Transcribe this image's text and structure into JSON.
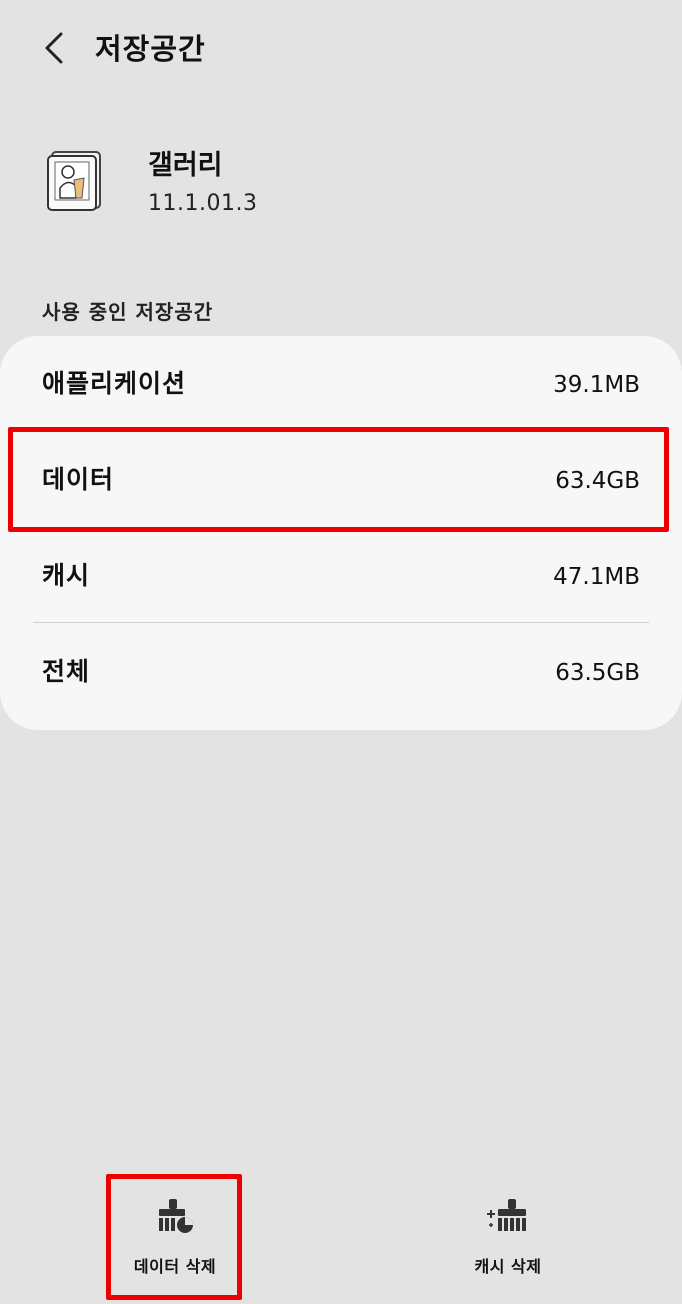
{
  "header": {
    "title": "저장공간",
    "back_icon": "chevron-left-icon"
  },
  "app": {
    "name": "갤러리",
    "version": "11.1.01.3",
    "icon": "gallery-app-icon"
  },
  "section": {
    "label": "사용 중인 저장공간"
  },
  "storage": {
    "rows": [
      {
        "label": "애플리케이션",
        "value": "39.1MB"
      },
      {
        "label": "데이터",
        "value": "63.4GB"
      },
      {
        "label": "캐시",
        "value": "47.1MB"
      },
      {
        "label": "전체",
        "value": "63.5GB"
      }
    ]
  },
  "actions": {
    "clear_data": {
      "label": "데이터 삭제",
      "icon": "clear-data-broom-icon"
    },
    "clear_cache": {
      "label": "캐시 삭제",
      "icon": "clear-cache-broom-icon"
    }
  },
  "colors": {
    "background": "#e3e3e3",
    "card": "#f7f7f7",
    "highlight": "#ee0000"
  }
}
